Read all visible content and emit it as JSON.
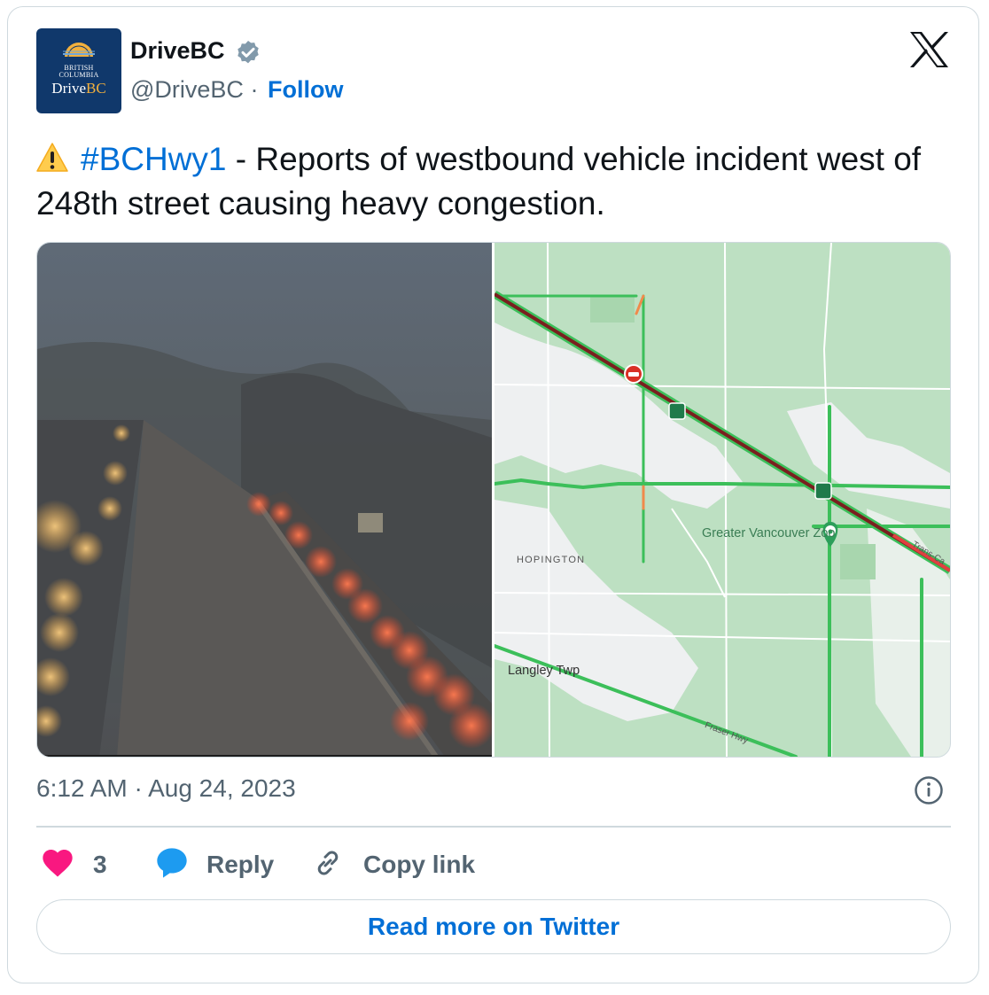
{
  "author": {
    "name": "DriveBC",
    "handle": "@DriveBC",
    "separator": "·",
    "follow_label": "Follow",
    "verified_color": "#829aab",
    "avatar": {
      "line1": "BRITISH",
      "line2": "COLUMBIA",
      "line3_a": "Drive",
      "line3_b": "BC",
      "bg": "#10386b"
    }
  },
  "tweet": {
    "hashtag": "#BCHwy1",
    "text": " - Reports of westbound vehicle incident west of 248th street causing heavy congestion."
  },
  "media": {
    "map_labels": {
      "zoo": "Greater Vancouver Zoo",
      "town": "HOPINGTON",
      "langley": "Langley Twp",
      "fraser": "Fraser Hwy",
      "trans_canada": "Trans-Ca"
    }
  },
  "timestamp": "6:12 AM · Aug 24, 2023",
  "actions": {
    "likes": "3",
    "reply_label": "Reply",
    "copy_label": "Copy link"
  },
  "read_more_label": "Read more on Twitter",
  "colors": {
    "link": "#006fd6",
    "heart": "#f91880",
    "reply": "#1d9bf0",
    "muted": "#536471",
    "border": "#cfd9de"
  },
  "icons": [
    "verified-badge-icon",
    "x-logo-icon",
    "warning-icon",
    "info-icon",
    "heart-icon",
    "reply-bubble-icon",
    "link-icon",
    "zoo-pin-icon",
    "incident-icon",
    "highway-shield-icon"
  ]
}
